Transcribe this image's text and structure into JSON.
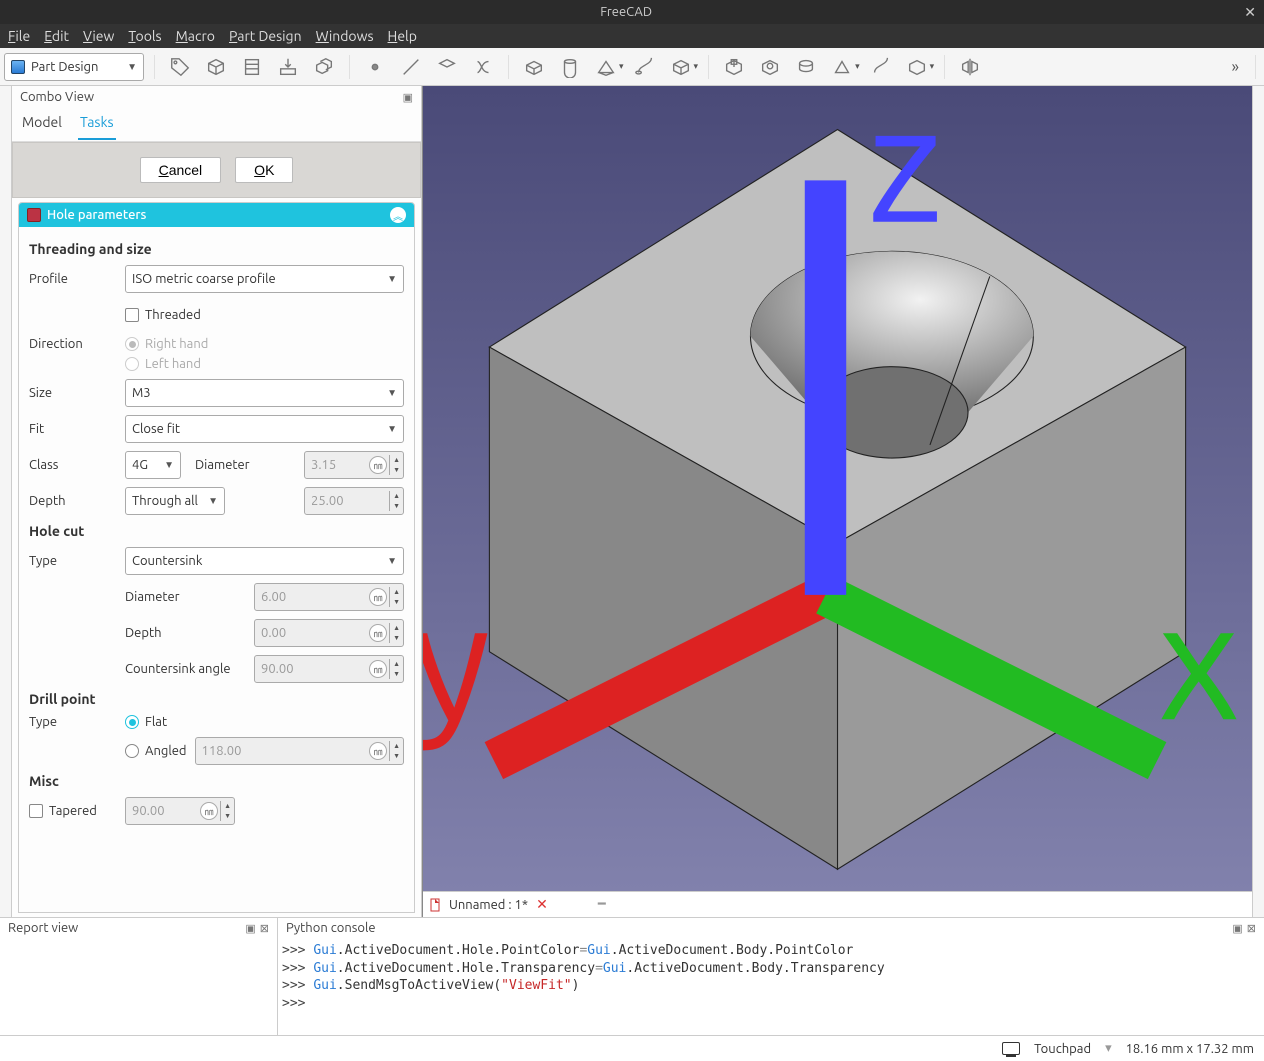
{
  "window": {
    "title": "FreeCAD"
  },
  "menubar": {
    "file": "File",
    "edit": "Edit",
    "view": "View",
    "tools": "Tools",
    "macro": "Macro",
    "partdesign": "Part Design",
    "windows": "Windows",
    "help": "Help"
  },
  "workbench": {
    "selected": "Part Design"
  },
  "combo": {
    "title": "Combo View",
    "tabs": {
      "model": "Model",
      "tasks": "Tasks"
    },
    "active_tab": "Tasks",
    "cancel": "Cancel",
    "ok": "OK"
  },
  "panel": {
    "title": "Hole parameters",
    "threading_section": "Threading and size",
    "profile_label": "Profile",
    "profile_value": "ISO metric coarse profile",
    "threaded_label": "Threaded",
    "threaded_checked": false,
    "direction_label": "Direction",
    "direction_rh": "Right hand",
    "direction_lh": "Left hand",
    "size_label": "Size",
    "size_value": "M3",
    "fit_label": "Fit",
    "fit_value": "Close fit",
    "class_label": "Class",
    "class_value": "4G",
    "diameter_label": "Diameter",
    "diameter_value": "3.15",
    "depth_label": "Depth",
    "depth_mode": "Through all",
    "depth_value": "25.00",
    "holecut_section": "Hole cut",
    "hc_type_label": "Type",
    "hc_type_value": "Countersink",
    "hc_diameter_label": "Diameter",
    "hc_diameter_value": "6.00",
    "hc_depth_label": "Depth",
    "hc_depth_value": "0.00",
    "hc_angle_label": "Countersink angle",
    "hc_angle_value": "90.00",
    "drillpoint_section": "Drill point",
    "dp_type_label": "Type",
    "dp_flat": "Flat",
    "dp_angled": "Angled",
    "dp_angled_value": "118.00",
    "misc_section": "Misc",
    "tapered_label": "Tapered",
    "tapered_value": "90.00"
  },
  "doc_tab": {
    "name": "Unnamed : 1*"
  },
  "bottom": {
    "report_title": "Report view",
    "py_title": "Python console",
    "py_lines": [
      ">>> Gui.ActiveDocument.Hole.PointColor=Gui.ActiveDocument.Body.PointColor",
      ">>> Gui.ActiveDocument.Hole.Transparency=Gui.ActiveDocument.Body.Transparency",
      ">>> Gui.SendMsgToActiveView(\"ViewFit\")",
      ">>> "
    ]
  },
  "statusbar": {
    "device": "Touchpad",
    "dims": "18.16 mm x 17.32 mm"
  }
}
